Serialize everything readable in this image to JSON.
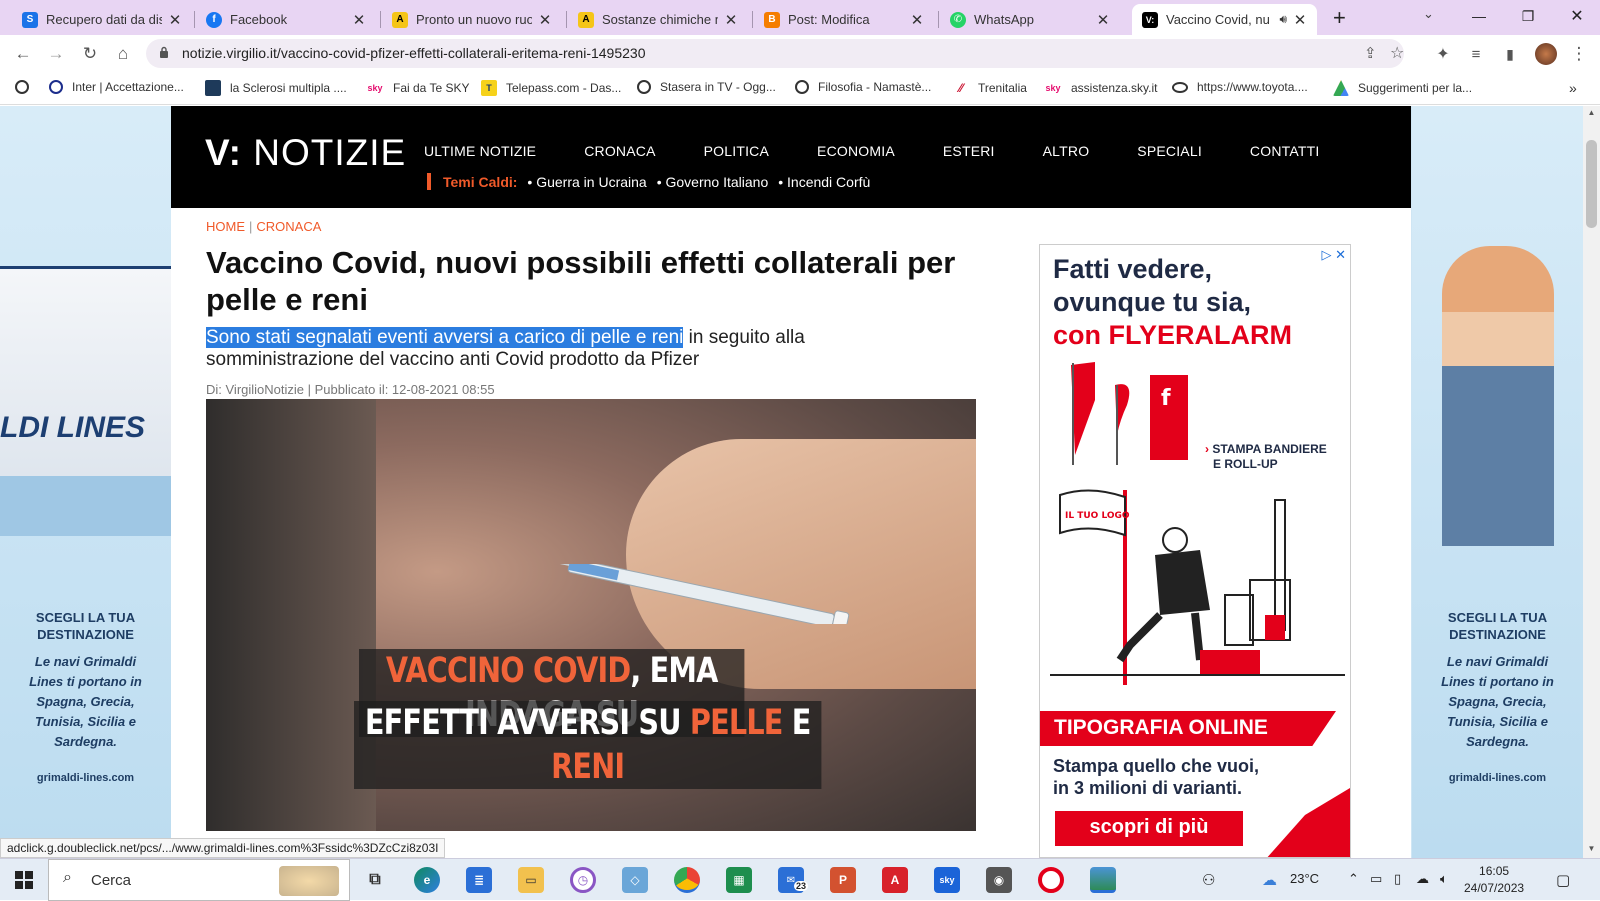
{
  "tabs": [
    {
      "title": "Recupero dati da disp",
      "favicon": "S",
      "color": "#1b73e8"
    },
    {
      "title": "Facebook",
      "favicon": "f",
      "color": "#1877f2"
    },
    {
      "title": "Pronto un nuovo ruol",
      "favicon": "A",
      "color": "#f5c518"
    },
    {
      "title": "Sostanze chimiche ne",
      "favicon": "A",
      "color": "#f5c518"
    },
    {
      "title": "Post: Modifica",
      "favicon": "B",
      "color": "#f57d00"
    },
    {
      "title": "WhatsApp",
      "favicon": "✆",
      "color": "#25d366"
    },
    {
      "title": "Vaccino Covid, nu",
      "favicon": "V:",
      "color": "#000000"
    }
  ],
  "toolbar": {
    "url": "notizie.virgilio.it/vaccino-covid-pfizer-effetti-collaterali-eritema-reni-1495230"
  },
  "bookmarks": [
    {
      "label": "",
      "icon": "globe-icon"
    },
    {
      "label": "Inter | Accettazione...",
      "icon": "inter-icon"
    },
    {
      "label": "la Sclerosi multipla ....",
      "icon": "monitor-icon"
    },
    {
      "label": "Fai da Te SKY",
      "icon": "sky-icon"
    },
    {
      "label": "Telepass.com - Das...",
      "icon": "telepass-icon"
    },
    {
      "label": "Stasera in TV - Ogg...",
      "icon": "globe-icon"
    },
    {
      "label": "Filosofia - Namastè...",
      "icon": "globe-icon"
    },
    {
      "label": "Trenitalia",
      "icon": "trenitalia-icon"
    },
    {
      "label": "assistenza.sky.it",
      "icon": "sky-icon"
    },
    {
      "label": "https://www.toyota....",
      "icon": "toyota-icon"
    },
    {
      "label": "Suggerimenti per la...",
      "icon": "google-drive-icon"
    }
  ],
  "site": {
    "logo_mark": "V:",
    "logo_word": "NOTIZIE",
    "nav": [
      "ULTIME NOTIZIE",
      "CRONACA",
      "POLITICA",
      "ECONOMIA",
      "ESTERI",
      "ALTRO",
      "SPECIALI",
      "CONTATTI"
    ],
    "hot_label": "Temi Caldi:",
    "hot_topics": [
      "• Guerra in Ucraina",
      "• Governo Italiano",
      "• Incendi Corfù"
    ]
  },
  "article": {
    "breadcrumb": [
      "HOME",
      "CRONACA"
    ],
    "title": "Vaccino Covid, nuovi possibili effetti collaterali per pelle e reni",
    "subtitle_selected": "Sono stati segnalati eventi avversi a carico di pelle e reni",
    "subtitle_rest": " in seguito alla somministrazione del vaccino anti Covid prodotto da Pfizer",
    "meta": "Di: VirgilioNotizie | Pubblicato il: 12-08-2021 08:55",
    "image_caption_line1_a": "VACCINO COVID",
    "image_caption_line1_b": ", EMA INDAGA SU",
    "image_caption_line2_a": "EFFETTI AVVERSI SU ",
    "image_caption_line2_b": "PELLE",
    "image_caption_line2_c": " E ",
    "image_caption_line2_d": "RENI"
  },
  "side_ad": {
    "line1": "SCEGLI LA TUA DESTINAZIONE",
    "line2": "Le navi Grimaldi Lines ti portano in Spagna, Grecia, Tunisia, Sicilia e Sardegna.",
    "line3": "grimaldi-lines.com",
    "ship_text": "LDI LINES"
  },
  "ad": {
    "headline_1": "Fatti vedere,",
    "headline_2": "ovunque tu sia,",
    "headline_3": "con FLYERALARM",
    "cta_1a": "STAMPA BANDIERE",
    "cta_1b": "E ROLL-UP",
    "logo_flag": "IL TUO LOGO",
    "band": "TIPOGRAFIA ONLINE",
    "body_1": "Stampa quello che vuoi,",
    "body_2": "in 3 milioni di varianti.",
    "button": "scopri di più"
  },
  "status_url": "adclick.g.doubleclick.net/pcs/.../www.grimaldi-lines.com%3Fssidc%3DZcCzi8z03I",
  "taskbar": {
    "search_placeholder": "Cerca",
    "weather": "23°C",
    "mail_badge": "23",
    "time": "16:05",
    "date": "24/07/2023"
  }
}
